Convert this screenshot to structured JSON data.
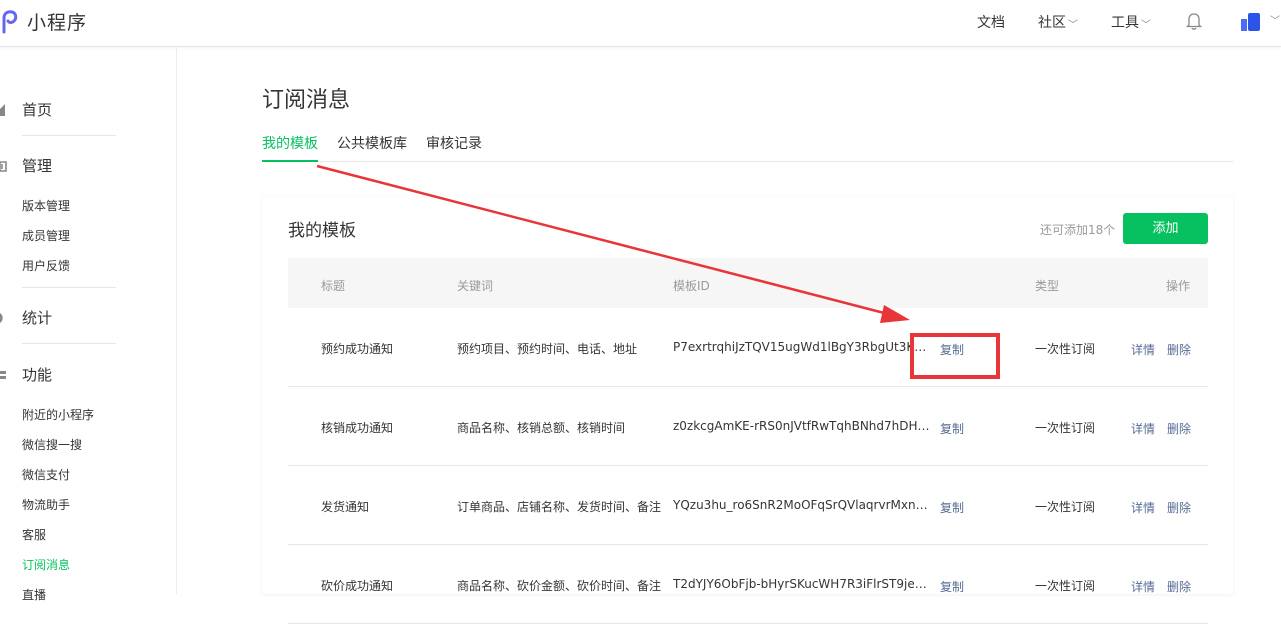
{
  "header": {
    "app_title": "小程序",
    "nav": [
      "文档",
      "社区",
      "工具"
    ]
  },
  "sidebar": {
    "groups": [
      {
        "label": "首页",
        "items": []
      },
      {
        "label": "管理",
        "items": [
          "版本管理",
          "成员管理",
          "用户反馈"
        ]
      },
      {
        "label": "统计",
        "items": []
      },
      {
        "label": "功能",
        "items": [
          "附近的小程序",
          "微信搜一搜",
          "微信支付",
          "物流助手",
          "客服",
          "订阅消息",
          "直播"
        ]
      }
    ],
    "active_item": "订阅消息"
  },
  "main": {
    "title": "订阅消息",
    "tabs": [
      "我的模板",
      "公共模板库",
      "审核记录"
    ],
    "active_tab": "我的模板"
  },
  "card": {
    "title": "我的模板",
    "remain_text": "还可添加18个",
    "add_label": "添加",
    "columns": [
      "标题",
      "关键词",
      "模板ID",
      "类型",
      "操作"
    ],
    "rows": [
      {
        "title": "预约成功通知",
        "keywords": "预约项目、预约时间、电话、地址",
        "template_id": "P7exrtrqhiJzTQV15ugWd1lBgY3RbgUt3KD...",
        "copy": "复制",
        "type": "一次性订阅",
        "detail": "详情",
        "delete": "删除"
      },
      {
        "title": "核销成功通知",
        "keywords": "商品名称、核销总额、核销时间",
        "template_id": "z0zkcgAmKE-rRS0nJVtfRwTqhBNhd7hDH1...",
        "copy": "复制",
        "type": "一次性订阅",
        "detail": "详情",
        "delete": "删除"
      },
      {
        "title": "发货通知",
        "keywords": "订单商品、店铺名称、发货时间、备注",
        "template_id": "YQzu3hu_ro6SnR2MoOFqSrQVlaqrvrMxn5...",
        "copy": "复制",
        "type": "一次性订阅",
        "detail": "详情",
        "delete": "删除"
      },
      {
        "title": "砍价成功通知",
        "keywords": "商品名称、砍价金额、砍价时间、备注",
        "template_id": "T2dYJY6ObFjb-bHyrSKucWH7R3iFlrST9jeLB...",
        "copy": "复制",
        "type": "一次性订阅",
        "detail": "详情",
        "delete": "删除"
      }
    ]
  },
  "colors": {
    "accent": "#07c160",
    "link": "#576b95",
    "annotation": "#e8353a"
  },
  "icons": [
    "logo-icon",
    "bell-icon",
    "avatar-icon",
    "home-icon",
    "manage-icon",
    "stats-icon",
    "features-icon"
  ]
}
